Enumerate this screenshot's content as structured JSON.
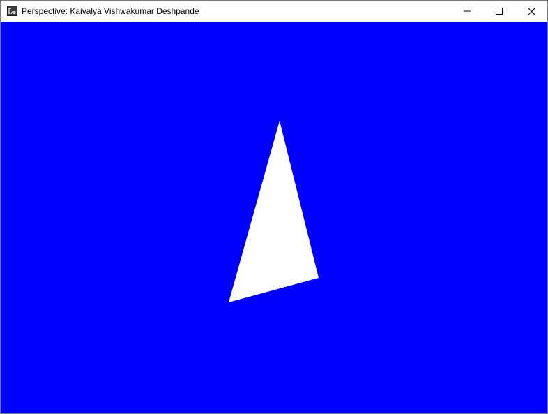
{
  "window": {
    "title": "Perspective: Kaivalya Vishwakumar Deshpande",
    "controls": {
      "minimize_icon": "minimize-icon",
      "maximize_icon": "maximize-icon",
      "close_icon": "close-icon"
    }
  },
  "canvas": {
    "background_color": "#0000ff",
    "shape": {
      "type": "triangle",
      "fill_color": "#ffffff"
    }
  }
}
